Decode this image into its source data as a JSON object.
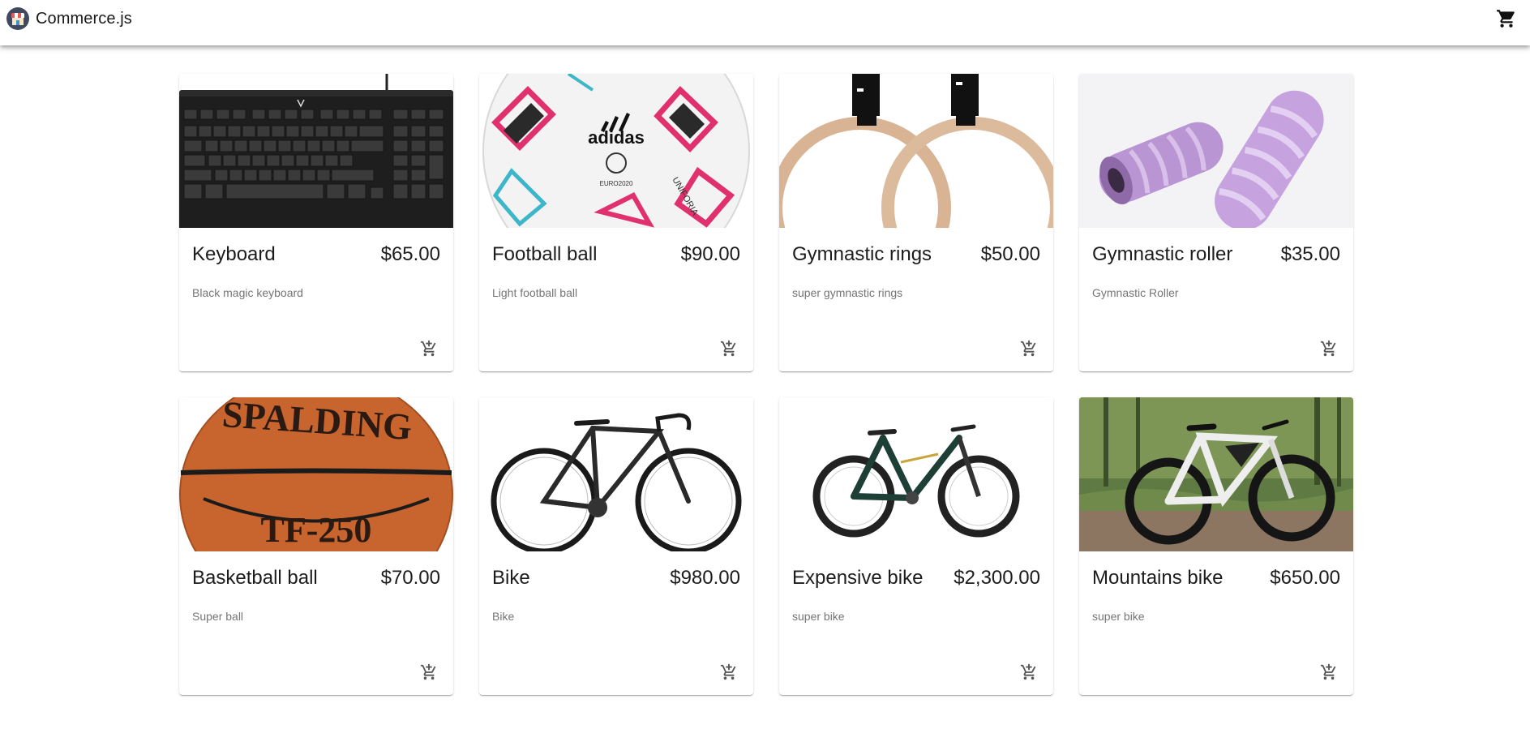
{
  "app": {
    "title": "Commerce.js"
  },
  "products": [
    {
      "name": "Keyboard",
      "price": "$65.00",
      "description": "Black magic keyboard",
      "image": "keyboard"
    },
    {
      "name": "Football ball",
      "price": "$90.00",
      "description": "Light football ball",
      "image": "football"
    },
    {
      "name": "Gymnastic rings",
      "price": "$50.00",
      "description": "super gymnastic rings",
      "image": "rings"
    },
    {
      "name": "Gymnastic roller",
      "price": "$35.00",
      "description": "Gymnastic Roller",
      "image": "roller"
    },
    {
      "name": "Basketball ball",
      "price": "$70.00",
      "description": "Super ball",
      "image": "basketball"
    },
    {
      "name": "Bike",
      "price": "$980.00",
      "description": "Bike",
      "image": "bike"
    },
    {
      "name": "Expensive bike",
      "price": "$2,300.00",
      "description": "super bike",
      "image": "expensive-bike"
    },
    {
      "name": "Mountains bike",
      "price": "$650.00",
      "description": "super bike",
      "image": "mountain-bike"
    }
  ],
  "icons": {
    "cart": "shopping-cart-icon",
    "add_to_cart": "add-shopping-cart-icon"
  }
}
